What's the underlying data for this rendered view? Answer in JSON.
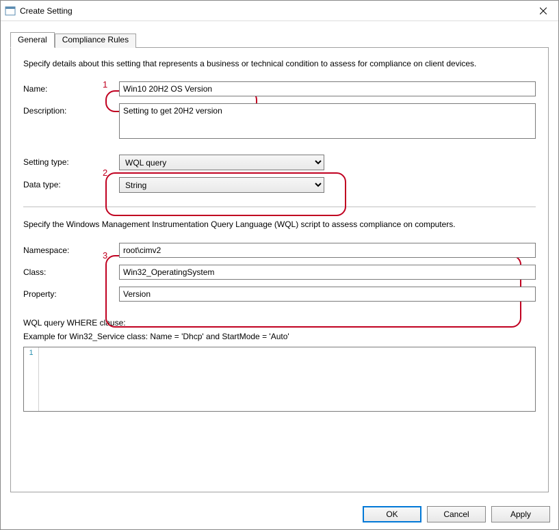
{
  "window": {
    "title": "Create Setting"
  },
  "tabs": {
    "general": "General",
    "compliance": "Compliance Rules"
  },
  "intro": "Specify details about this setting that represents a business or technical condition to assess for compliance on client devices.",
  "labels": {
    "name": "Name:",
    "description": "Description:",
    "settingType": "Setting type:",
    "dataType": "Data type:",
    "namespace": "Namespace:",
    "class": "Class:",
    "property": "Property:",
    "whereClause": "WQL query WHERE clause:",
    "example": "Example for Win32_Service class: Name = 'Dhcp' and StartMode = 'Auto'"
  },
  "fields": {
    "name": "Win10 20H2 OS Version",
    "description": "Setting to get 20H2 version",
    "settingType": "WQL query",
    "dataType": "String",
    "namespace": "root\\cimv2",
    "class": "Win32_OperatingSystem",
    "property": "Version",
    "whereLine": "1"
  },
  "wqlSection": "Specify the Windows Management Instrumentation Query Language (WQL) script to assess compliance on computers.",
  "annotations": {
    "a1": "1",
    "a2": "2",
    "a3": "3"
  },
  "buttons": {
    "ok": "OK",
    "cancel": "Cancel",
    "apply": "Apply"
  }
}
